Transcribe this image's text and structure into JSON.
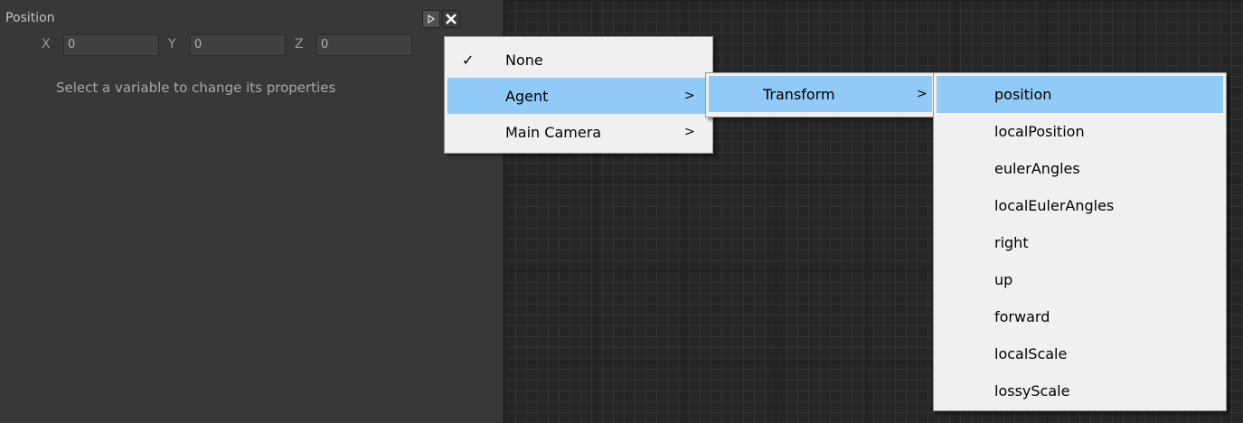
{
  "inspector": {
    "title": "Position",
    "x_label": "X",
    "x_value": "0",
    "y_label": "Y",
    "y_value": "0",
    "z_label": "Z",
    "z_value": "0",
    "hint": "Select a variable to change its properties",
    "play_icon": "play-icon",
    "close_icon": "close-icon"
  },
  "menu_level1": {
    "items": [
      {
        "label": "None",
        "checked": true
      },
      {
        "label": "Agent",
        "arrow": ">",
        "highlighted": true
      },
      {
        "label": "Main Camera",
        "arrow": ">"
      }
    ]
  },
  "menu_level2": {
    "items": [
      {
        "label": "Transform",
        "arrow": ">",
        "highlighted": true
      }
    ]
  },
  "menu_level3": {
    "items": [
      {
        "label": "position",
        "highlighted": true
      },
      {
        "label": "localPosition"
      },
      {
        "label": "eulerAngles"
      },
      {
        "label": "localEulerAngles"
      },
      {
        "label": "right"
      },
      {
        "label": "up"
      },
      {
        "label": "forward"
      },
      {
        "label": "localScale"
      },
      {
        "label": "lossyScale"
      }
    ]
  },
  "colors": {
    "highlight": "#91c9f7",
    "panel": "#383838",
    "canvas": "#262626"
  }
}
